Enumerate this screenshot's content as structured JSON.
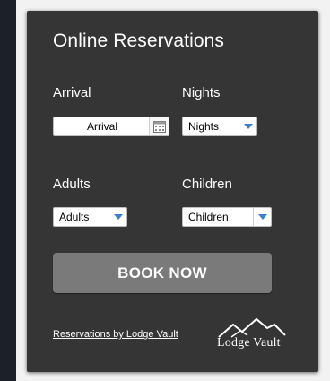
{
  "widget": {
    "title": "Online Reservations",
    "arrival": {
      "label": "Arrival",
      "value": "Arrival",
      "icon": "calendar-icon"
    },
    "nights": {
      "label": "Nights",
      "value": "Nights",
      "icon": "chevron-down-icon"
    },
    "adults": {
      "label": "Adults",
      "value": "Adults",
      "icon": "chevron-down-icon"
    },
    "children": {
      "label": "Children",
      "value": "Children",
      "icon": "chevron-down-icon"
    },
    "book_button": "BOOK NOW",
    "footer_link": "Reservations by Lodge Vault",
    "logo_text": "Lodge Vault"
  },
  "colors": {
    "panel": "#353535",
    "button": "#7a7a7a",
    "arrow": "#3b7fd0",
    "page_dark": "#1c2029",
    "page_light": "#f2f2f2"
  }
}
